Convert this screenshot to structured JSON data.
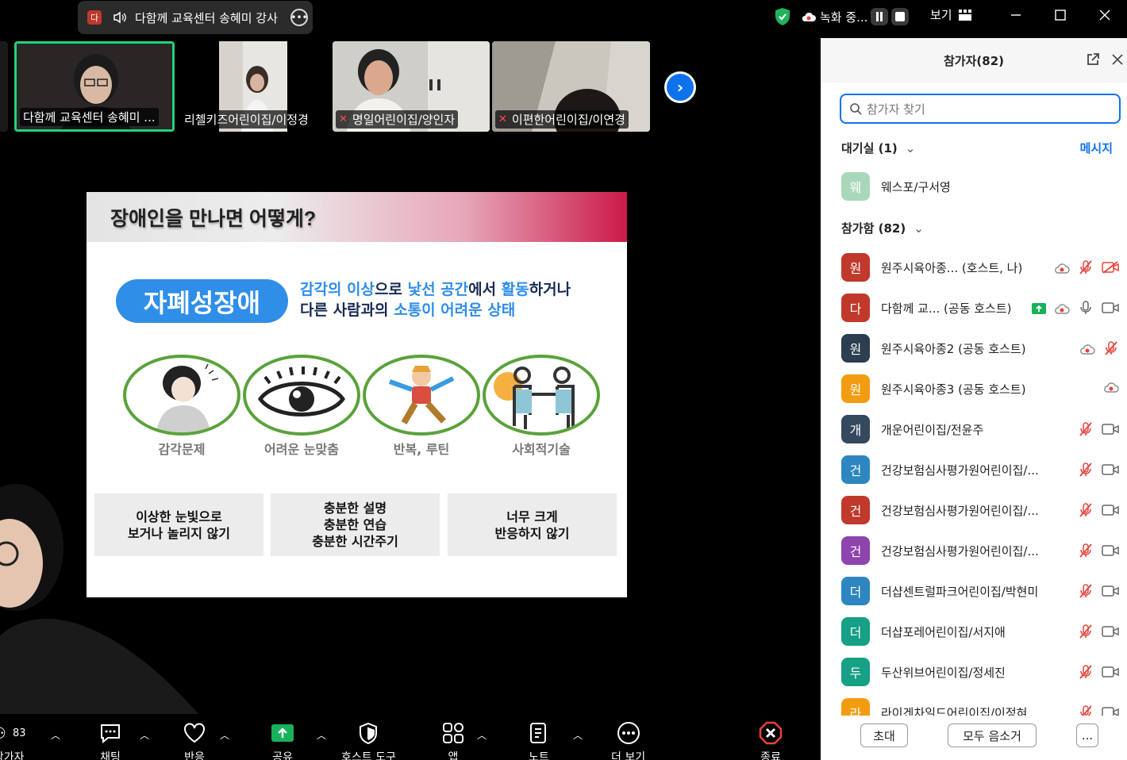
{
  "speaker_chip": {
    "avatar_letter": "다",
    "name": "다함께 교육센터 송혜미 강사"
  },
  "recording": {
    "label": "녹화 중..."
  },
  "view": {
    "label": "보기"
  },
  "thumbnails": [
    {
      "name": "다함께 교육센터 송혜미 ...",
      "muted": false,
      "active": true
    },
    {
      "name": "리첼키즈어린이집/이정경",
      "muted": false,
      "active": false
    },
    {
      "name": "명일어린이집/양인자",
      "muted": true,
      "active": false
    },
    {
      "name": "이편한어린이집/이연경",
      "muted": true,
      "active": false
    }
  ],
  "slide": {
    "title": "장애인을 만나면 어떻게?",
    "pill": "자폐성장애",
    "desc_line1": [
      {
        "t": "감각의 이상",
        "hl": true
      },
      {
        "t": "으로 ",
        "hl": false
      },
      {
        "t": "낯선 공간",
        "hl": true
      },
      {
        "t": "에서 ",
        "hl": false
      },
      {
        "t": "활동",
        "hl": true
      },
      {
        "t": "하거나",
        "hl": false
      }
    ],
    "desc_line2": [
      {
        "t": "다른 사람과의 ",
        "hl": false
      },
      {
        "t": "소통이 어려운 상태",
        "hl": true
      }
    ],
    "circles": [
      "감각문제",
      "어려운 눈맞춤",
      "반복, 루틴",
      "사회적기술"
    ],
    "boxes": [
      [
        "이상한 눈빛으로",
        "보거나 놀리지 않기"
      ],
      [
        "충분한 설명",
        "충분한 연습",
        "충분한 시간주기"
      ],
      [
        "너무 크게",
        "반응하지 않기"
      ]
    ]
  },
  "toolbar": {
    "participants_count": "83",
    "items": [
      {
        "label": "참가자"
      },
      {
        "label": "채팅"
      },
      {
        "label": "반응"
      },
      {
        "label": "공유"
      },
      {
        "label": "호스트 도구"
      },
      {
        "label": "앱"
      },
      {
        "label": "노트"
      },
      {
        "label": "더 보기"
      },
      {
        "label": "종료"
      }
    ]
  },
  "panel": {
    "title": "참가자(82)",
    "search_placeholder": "참가자 찾기",
    "waiting_label": "대기실 (1)",
    "message_label": "메시지",
    "waiting": [
      {
        "letter": "웨",
        "name": "웨스포/구서영",
        "color": "#a8d8b9"
      }
    ],
    "joined_label": "참가함 (82)",
    "participants": [
      {
        "letter": "원",
        "name": "원주시육아종...   (호스트, 나)",
        "color": "#c0392b",
        "icons": [
          "rec",
          "mic-muted",
          "cam-off"
        ]
      },
      {
        "letter": "다",
        "name": "다함께 교... (공동 호스트)",
        "color": "#c0392b",
        "icons": [
          "share",
          "rec",
          "mic",
          "cam"
        ]
      },
      {
        "letter": "원",
        "name": "원주시육아종2 (공동 호스트)",
        "color": "#2c3e50",
        "icons": [
          "rec",
          "mic-muted"
        ]
      },
      {
        "letter": "원",
        "name": "원주시육아종3 (공동 호스트)",
        "color": "#f39c12",
        "icons": [
          "rec"
        ]
      },
      {
        "letter": "개",
        "name": "개운어린이집/전윤주",
        "color": "#34495e",
        "icons": [
          "mic-muted",
          "cam"
        ]
      },
      {
        "letter": "건",
        "name": "건강보험심사평가원어린이집/...",
        "color": "#2e86c1",
        "icons": [
          "mic-muted",
          "cam"
        ]
      },
      {
        "letter": "건",
        "name": "건강보험심사평가원어린이집/...",
        "color": "#c0392b",
        "icons": [
          "mic-muted",
          "cam"
        ]
      },
      {
        "letter": "건",
        "name": "건강보험심사평가원어린이집/...",
        "color": "#8e44ad",
        "icons": [
          "mic-muted",
          "cam"
        ]
      },
      {
        "letter": "더",
        "name": "더샵센트럴파크어린이집/박현미",
        "color": "#2e86c1",
        "icons": [
          "mic-muted",
          "cam"
        ]
      },
      {
        "letter": "더",
        "name": "더샵포레어린이집/서지애",
        "color": "#16a085",
        "icons": [
          "mic-muted",
          "cam"
        ]
      },
      {
        "letter": "두",
        "name": "두산위브어린이집/정세진",
        "color": "#16a085",
        "icons": [
          "mic-muted",
          "cam"
        ]
      },
      {
        "letter": "라",
        "name": "라이겐차일드어린이집/이정혀",
        "color": "#f39c12",
        "icons": [
          "mic-muted",
          "cam"
        ]
      }
    ],
    "footer": {
      "invite": "초대",
      "mute_all": "모두 음소거",
      "more": "..."
    }
  },
  "colors": {
    "accent": "#0e72ed",
    "active_border": "#22d37a",
    "muted_red": "#e8423b"
  }
}
